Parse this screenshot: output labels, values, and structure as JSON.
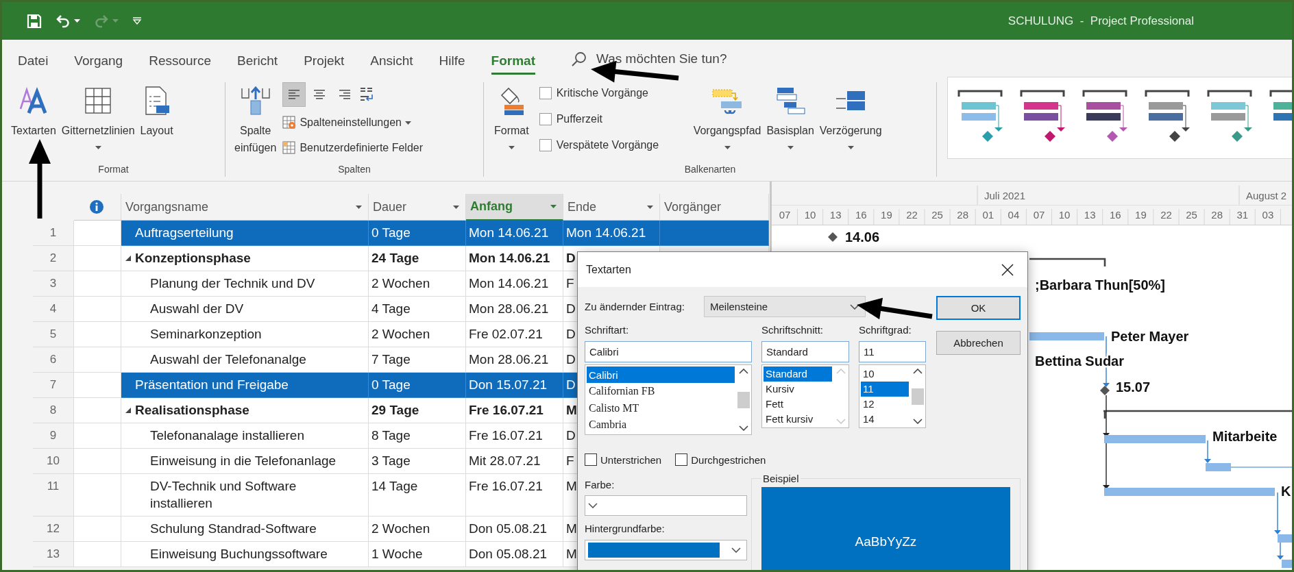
{
  "window": {
    "title": "SCHULUNG  -  Project Professional"
  },
  "menu_tabs": [
    {
      "label": "Datei",
      "selected": false
    },
    {
      "label": "Vorgang",
      "selected": false
    },
    {
      "label": "Ressource",
      "selected": false
    },
    {
      "label": "Bericht",
      "selected": false
    },
    {
      "label": "Projekt",
      "selected": false
    },
    {
      "label": "Ansicht",
      "selected": false
    },
    {
      "label": "Hilfe",
      "selected": false
    },
    {
      "label": "Format",
      "selected": true
    }
  ],
  "search": {
    "placeholder": "Was möchten Sie tun?"
  },
  "ribbon": {
    "format_group": {
      "label": "Format",
      "buttons": [
        {
          "label": "Textarten",
          "dropdown": false
        },
        {
          "label": "Gitternetzlinien",
          "dropdown": true
        },
        {
          "label": "Layout",
          "dropdown": false
        }
      ]
    },
    "columns_group": {
      "label": "Spalten",
      "insert_button": {
        "label": "Spalte einfügen"
      },
      "alignment": [
        {
          "selected": true
        },
        {
          "selected": false
        },
        {
          "selected": false
        }
      ],
      "commands": [
        {
          "label": "Spalteneinstellungen",
          "dropdown": true
        },
        {
          "label": "Benutzerdefinierte Felder",
          "dropdown": false
        }
      ]
    },
    "bar_styles_group": {
      "label": "Balkenarten",
      "format_button": {
        "label": "Format",
        "dropdown": true
      },
      "checkboxes": [
        {
          "label": "Kritische Vorgänge",
          "checked": false
        },
        {
          "label": "Pufferzeit",
          "checked": false
        },
        {
          "label": "Verspätete Vorgänge",
          "checked": false
        }
      ],
      "buttons": [
        {
          "label": "Vorgangspfad",
          "dropdown": true
        },
        {
          "label": "Basisplan",
          "dropdown": true
        },
        {
          "label": "Verzögerung",
          "dropdown": true
        }
      ]
    }
  },
  "table": {
    "columns": [
      {
        "label": "Vorgangsname",
        "filter": true,
        "selected": false
      },
      {
        "label": "Dauer",
        "filter": true,
        "selected": false
      },
      {
        "label": "Anfang",
        "filter": true,
        "selected": true
      },
      {
        "label": "Ende",
        "filter": true,
        "selected": false
      },
      {
        "label": "Vorgänger",
        "filter": false,
        "selected": false
      }
    ],
    "rows": [
      {
        "number": "1",
        "name": "Auftragserteilung",
        "duration": "0 Tage",
        "start": "Mon 14.06.21",
        "finish": "Mon 14.06.21",
        "selected": true
      },
      {
        "number": "2",
        "name": "Konzeptionsphase",
        "duration": "24 Tage",
        "start": "Mon 14.06.21",
        "finish": "D",
        "selected": false,
        "expanded": true,
        "children": [
          {
            "number": "3",
            "name": "Planung der Technik und DV",
            "duration": "2 Wochen",
            "start": "Mon 14.06.21",
            "finish": "F",
            "selected": false
          },
          {
            "number": "4",
            "name": "Auswahl der DV",
            "duration": "4 Tage",
            "start": "Mon 28.06.21",
            "finish": "D",
            "selected": false
          },
          {
            "number": "5",
            "name": "Seminarkonzeption",
            "duration": "2 Wochen",
            "start": "Fre 02.07.21",
            "finish": "D",
            "selected": false
          },
          {
            "number": "6",
            "name": "Auswahl der Telefonanalge",
            "duration": "7 Tage",
            "start": "Mon 28.06.21",
            "finish": "D",
            "selected": false
          }
        ]
      },
      {
        "number": "7",
        "name": "Präsentation und Freigabe",
        "duration": "0 Tage",
        "start": "Don 15.07.21",
        "finish": "D",
        "selected": true
      },
      {
        "number": "8",
        "name": "Realisationsphase",
        "duration": "29 Tage",
        "start": "Fre 16.07.21",
        "finish": "M",
        "selected": false,
        "expanded": true,
        "children": [
          {
            "number": "9",
            "name": "Telefonanalage installieren",
            "duration": "8 Tage",
            "start": "Fre 16.07.21",
            "finish": "D",
            "selected": false
          },
          {
            "number": "10",
            "name": "Einweisung in die Telefonanlage",
            "duration": "3 Tage",
            "start": "Mit 28.07.21",
            "finish": "F",
            "selected": false
          },
          {
            "number": "11",
            "name": "DV-Technik und Software installieren",
            "duration": "14 Tage",
            "start": "Fre 16.07.21",
            "finish": "M",
            "selected": false
          },
          {
            "number": "12",
            "name": "Schulung Standrad-Software",
            "duration": "2 Wochen",
            "start": "Don 05.08.21",
            "finish": "M",
            "selected": false
          },
          {
            "number": "13",
            "name": "Einweisung Buchungssoftware",
            "duration": "1 Woche",
            "start": "Don 05.08.21",
            "finish": "M",
            "selected": false
          }
        ]
      }
    ]
  },
  "gantt": {
    "months": [
      "Juli 2021",
      "August 2"
    ],
    "days": [
      "07",
      "10",
      "13",
      "16",
      "19",
      "22",
      "25",
      "28",
      "01",
      "04",
      "07",
      "10",
      "13",
      "16",
      "19",
      "22",
      "25",
      "28",
      "31",
      "03"
    ],
    "labels": [
      "14.06",
      ";Barbara Thun[50%]",
      "Peter Mayer",
      "Bettina Sudar",
      "15.07",
      "Mitarbeite",
      "K"
    ]
  },
  "dialog": {
    "title": "Textarten",
    "entry": {
      "label": "Zu ändernder Eintrag:",
      "value": "Meilensteine"
    },
    "font": {
      "label": "Schriftart:",
      "value": "Calibri",
      "scroll_enabled": true,
      "options": [
        {
          "label": "Calibri",
          "selected": true
        },
        {
          "label": "Californian FB",
          "selected": false
        },
        {
          "label": "Calisto MT",
          "selected": false
        },
        {
          "label": "Cambria",
          "selected": false
        }
      ]
    },
    "style": {
      "label": "Schriftschnitt:",
      "value": "Standard",
      "scroll_enabled": false,
      "options": [
        {
          "label": "Standard",
          "selected": true
        },
        {
          "label": "Kursiv",
          "selected": false
        },
        {
          "label": "Fett",
          "selected": false
        },
        {
          "label": "Fett kursiv",
          "selected": false
        }
      ]
    },
    "size": {
      "label": "Schriftgrad:",
      "value": "11",
      "scroll_enabled": true,
      "options": [
        {
          "label": "10",
          "selected": false
        },
        {
          "label": "11",
          "selected": true
        },
        {
          "label": "12",
          "selected": false
        },
        {
          "label": "14",
          "selected": false
        }
      ]
    },
    "effects": [
      {
        "label": "Unterstrichen",
        "checked": false
      },
      {
        "label": "Durchgestrichen",
        "checked": false
      }
    ],
    "text_color": {
      "label": "Farbe:"
    },
    "background_color": {
      "label": "Hintergrundfarbe:",
      "color": "#0070c0"
    },
    "sample": {
      "label": "Beispiel",
      "text": "AaBbYyZz"
    },
    "buttons": [
      {
        "label": "OK",
        "default": true
      },
      {
        "label": "Abbrechen",
        "default": false
      }
    ]
  }
}
